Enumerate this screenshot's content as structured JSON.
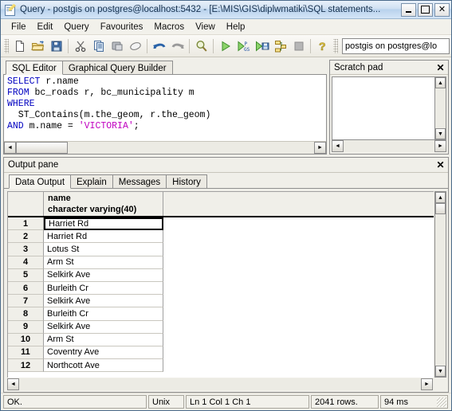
{
  "window": {
    "title": "Query - postgis on postgres@localhost:5432 - [E:\\MIS\\GIS\\diplwmatiki\\SQL statements...",
    "app_icon": "query-document-pencil-icon",
    "buttons": {
      "minimize": "_",
      "maximize": "□",
      "close": "✕"
    }
  },
  "menubar": {
    "items": [
      {
        "label": "File",
        "name": "menu-file"
      },
      {
        "label": "Edit",
        "name": "menu-edit"
      },
      {
        "label": "Query",
        "name": "menu-query"
      },
      {
        "label": "Favourites",
        "name": "menu-favourites"
      },
      {
        "label": "Macros",
        "name": "menu-macros"
      },
      {
        "label": "View",
        "name": "menu-view"
      },
      {
        "label": "Help",
        "name": "menu-help"
      }
    ]
  },
  "toolbar": {
    "buttons": [
      {
        "name": "new-file-icon",
        "title": "New"
      },
      {
        "name": "open-folder-icon",
        "title": "Open"
      },
      {
        "name": "save-icon",
        "title": "Save"
      },
      {
        "name": "cut-scissors-icon",
        "title": "Cut"
      },
      {
        "name": "copy-icon",
        "title": "Copy"
      },
      {
        "name": "paste-icon",
        "title": "Paste"
      },
      {
        "name": "eraser-icon",
        "title": "Clear window"
      },
      {
        "name": "undo-icon",
        "title": "Undo"
      },
      {
        "name": "redo-icon",
        "title": "Redo"
      },
      {
        "name": "find-magnifier-icon",
        "title": "Find"
      },
      {
        "name": "execute-query-icon",
        "title": "Execute query"
      },
      {
        "name": "execute-pgscript-icon",
        "title": "Execute pgScript"
      },
      {
        "name": "execute-to-file-icon",
        "title": "Execute to file"
      },
      {
        "name": "explain-query-icon",
        "title": "Explain query"
      },
      {
        "name": "stop-icon",
        "title": "Cancel"
      },
      {
        "name": "help-question-icon",
        "title": "Help"
      }
    ],
    "connection": "postgis on postgres@lo"
  },
  "sql_panel": {
    "tabs": [
      {
        "label": "SQL Editor",
        "active": true
      },
      {
        "label": "Graphical Query Builder",
        "active": false
      }
    ],
    "code_lines": [
      {
        "parts": [
          {
            "t": "SELECT",
            "k": "kw"
          },
          {
            "t": " r.name",
            "k": ""
          }
        ]
      },
      {
        "parts": [
          {
            "t": "FROM",
            "k": "kw"
          },
          {
            "t": " bc_roads r, bc_municipality m",
            "k": ""
          }
        ]
      },
      {
        "parts": [
          {
            "t": "WHERE",
            "k": "kw"
          }
        ]
      },
      {
        "parts": [
          {
            "t": "  ST_Contains(m.the_geom, r.the_geom)",
            "k": ""
          }
        ]
      },
      {
        "parts": [
          {
            "t": "AND",
            "k": "kw"
          },
          {
            "t": " m.name = ",
            "k": ""
          },
          {
            "t": "'VICTORIA'",
            "k": "str"
          },
          {
            "t": ";",
            "k": ""
          }
        ]
      }
    ]
  },
  "scratch_pad": {
    "title": "Scratch pad",
    "content": "",
    "close": "✕"
  },
  "output_pane": {
    "title": "Output pane",
    "close": "✕",
    "tabs": [
      {
        "label": "Data Output",
        "active": true
      },
      {
        "label": "Explain",
        "active": false
      },
      {
        "label": "Messages",
        "active": false
      },
      {
        "label": "History",
        "active": false
      }
    ],
    "grid": {
      "column_header": {
        "name": "name",
        "type": "character varying(40)"
      },
      "rows": [
        {
          "n": "1",
          "name": "Harriet Rd",
          "selected": true
        },
        {
          "n": "2",
          "name": "Harriet Rd",
          "selected": false
        },
        {
          "n": "3",
          "name": "Lotus St",
          "selected": false
        },
        {
          "n": "4",
          "name": "Arm St",
          "selected": false
        },
        {
          "n": "5",
          "name": "Selkirk Ave",
          "selected": false
        },
        {
          "n": "6",
          "name": "Burleith Cr",
          "selected": false
        },
        {
          "n": "7",
          "name": "Selkirk Ave",
          "selected": false
        },
        {
          "n": "8",
          "name": "Burleith Cr",
          "selected": false
        },
        {
          "n": "9",
          "name": "Selkirk Ave",
          "selected": false
        },
        {
          "n": "10",
          "name": "Arm St",
          "selected": false
        },
        {
          "n": "11",
          "name": "Coventry Ave",
          "selected": false
        },
        {
          "n": "12",
          "name": "Northcott Ave",
          "selected": false
        }
      ]
    }
  },
  "statusbar": {
    "message": "OK.",
    "line_ending": "Unix",
    "position": "Ln 1 Col 1 Ch 1",
    "rows": "2041 rows.",
    "time": "94 ms"
  },
  "colors": {
    "keyword": "#0000c0",
    "string": "#c000c0",
    "titlebar": "#b9d2ec",
    "face": "#f0efe9"
  }
}
